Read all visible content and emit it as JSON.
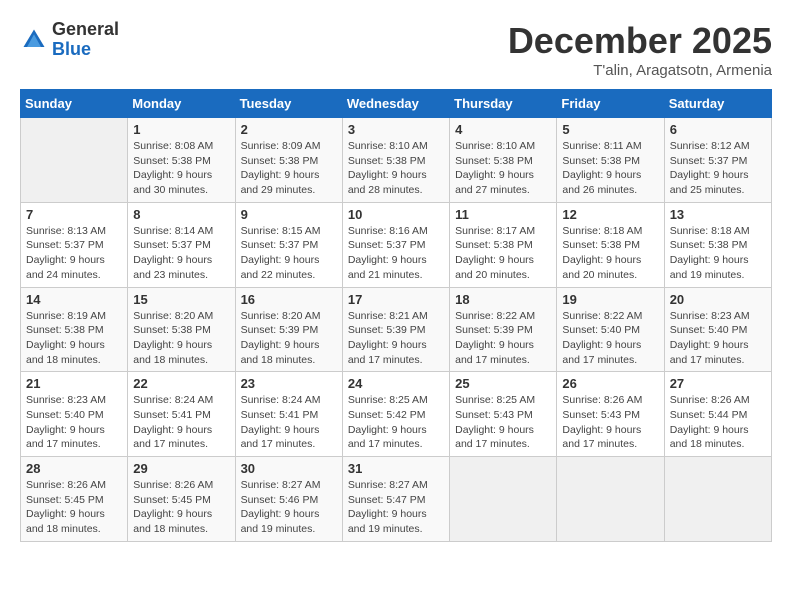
{
  "logo": {
    "general": "General",
    "blue": "Blue"
  },
  "title": "December 2025",
  "subtitle": "T'alin, Aragatsotn, Armenia",
  "days_header": [
    "Sunday",
    "Monday",
    "Tuesday",
    "Wednesday",
    "Thursday",
    "Friday",
    "Saturday"
  ],
  "weeks": [
    [
      {
        "day": "",
        "info": ""
      },
      {
        "day": "1",
        "info": "Sunrise: 8:08 AM\nSunset: 5:38 PM\nDaylight: 9 hours\nand 30 minutes."
      },
      {
        "day": "2",
        "info": "Sunrise: 8:09 AM\nSunset: 5:38 PM\nDaylight: 9 hours\nand 29 minutes."
      },
      {
        "day": "3",
        "info": "Sunrise: 8:10 AM\nSunset: 5:38 PM\nDaylight: 9 hours\nand 28 minutes."
      },
      {
        "day": "4",
        "info": "Sunrise: 8:10 AM\nSunset: 5:38 PM\nDaylight: 9 hours\nand 27 minutes."
      },
      {
        "day": "5",
        "info": "Sunrise: 8:11 AM\nSunset: 5:38 PM\nDaylight: 9 hours\nand 26 minutes."
      },
      {
        "day": "6",
        "info": "Sunrise: 8:12 AM\nSunset: 5:37 PM\nDaylight: 9 hours\nand 25 minutes."
      }
    ],
    [
      {
        "day": "7",
        "info": "Sunrise: 8:13 AM\nSunset: 5:37 PM\nDaylight: 9 hours\nand 24 minutes."
      },
      {
        "day": "8",
        "info": "Sunrise: 8:14 AM\nSunset: 5:37 PM\nDaylight: 9 hours\nand 23 minutes."
      },
      {
        "day": "9",
        "info": "Sunrise: 8:15 AM\nSunset: 5:37 PM\nDaylight: 9 hours\nand 22 minutes."
      },
      {
        "day": "10",
        "info": "Sunrise: 8:16 AM\nSunset: 5:37 PM\nDaylight: 9 hours\nand 21 minutes."
      },
      {
        "day": "11",
        "info": "Sunrise: 8:17 AM\nSunset: 5:38 PM\nDaylight: 9 hours\nand 20 minutes."
      },
      {
        "day": "12",
        "info": "Sunrise: 8:18 AM\nSunset: 5:38 PM\nDaylight: 9 hours\nand 20 minutes."
      },
      {
        "day": "13",
        "info": "Sunrise: 8:18 AM\nSunset: 5:38 PM\nDaylight: 9 hours\nand 19 minutes."
      }
    ],
    [
      {
        "day": "14",
        "info": "Sunrise: 8:19 AM\nSunset: 5:38 PM\nDaylight: 9 hours\nand 18 minutes."
      },
      {
        "day": "15",
        "info": "Sunrise: 8:20 AM\nSunset: 5:38 PM\nDaylight: 9 hours\nand 18 minutes."
      },
      {
        "day": "16",
        "info": "Sunrise: 8:20 AM\nSunset: 5:39 PM\nDaylight: 9 hours\nand 18 minutes."
      },
      {
        "day": "17",
        "info": "Sunrise: 8:21 AM\nSunset: 5:39 PM\nDaylight: 9 hours\nand 17 minutes."
      },
      {
        "day": "18",
        "info": "Sunrise: 8:22 AM\nSunset: 5:39 PM\nDaylight: 9 hours\nand 17 minutes."
      },
      {
        "day": "19",
        "info": "Sunrise: 8:22 AM\nSunset: 5:40 PM\nDaylight: 9 hours\nand 17 minutes."
      },
      {
        "day": "20",
        "info": "Sunrise: 8:23 AM\nSunset: 5:40 PM\nDaylight: 9 hours\nand 17 minutes."
      }
    ],
    [
      {
        "day": "21",
        "info": "Sunrise: 8:23 AM\nSunset: 5:40 PM\nDaylight: 9 hours\nand 17 minutes."
      },
      {
        "day": "22",
        "info": "Sunrise: 8:24 AM\nSunset: 5:41 PM\nDaylight: 9 hours\nand 17 minutes."
      },
      {
        "day": "23",
        "info": "Sunrise: 8:24 AM\nSunset: 5:41 PM\nDaylight: 9 hours\nand 17 minutes."
      },
      {
        "day": "24",
        "info": "Sunrise: 8:25 AM\nSunset: 5:42 PM\nDaylight: 9 hours\nand 17 minutes."
      },
      {
        "day": "25",
        "info": "Sunrise: 8:25 AM\nSunset: 5:43 PM\nDaylight: 9 hours\nand 17 minutes."
      },
      {
        "day": "26",
        "info": "Sunrise: 8:26 AM\nSunset: 5:43 PM\nDaylight: 9 hours\nand 17 minutes."
      },
      {
        "day": "27",
        "info": "Sunrise: 8:26 AM\nSunset: 5:44 PM\nDaylight: 9 hours\nand 18 minutes."
      }
    ],
    [
      {
        "day": "28",
        "info": "Sunrise: 8:26 AM\nSunset: 5:45 PM\nDaylight: 9 hours\nand 18 minutes."
      },
      {
        "day": "29",
        "info": "Sunrise: 8:26 AM\nSunset: 5:45 PM\nDaylight: 9 hours\nand 18 minutes."
      },
      {
        "day": "30",
        "info": "Sunrise: 8:27 AM\nSunset: 5:46 PM\nDaylight: 9 hours\nand 19 minutes."
      },
      {
        "day": "31",
        "info": "Sunrise: 8:27 AM\nSunset: 5:47 PM\nDaylight: 9 hours\nand 19 minutes."
      },
      {
        "day": "",
        "info": ""
      },
      {
        "day": "",
        "info": ""
      },
      {
        "day": "",
        "info": ""
      }
    ]
  ]
}
